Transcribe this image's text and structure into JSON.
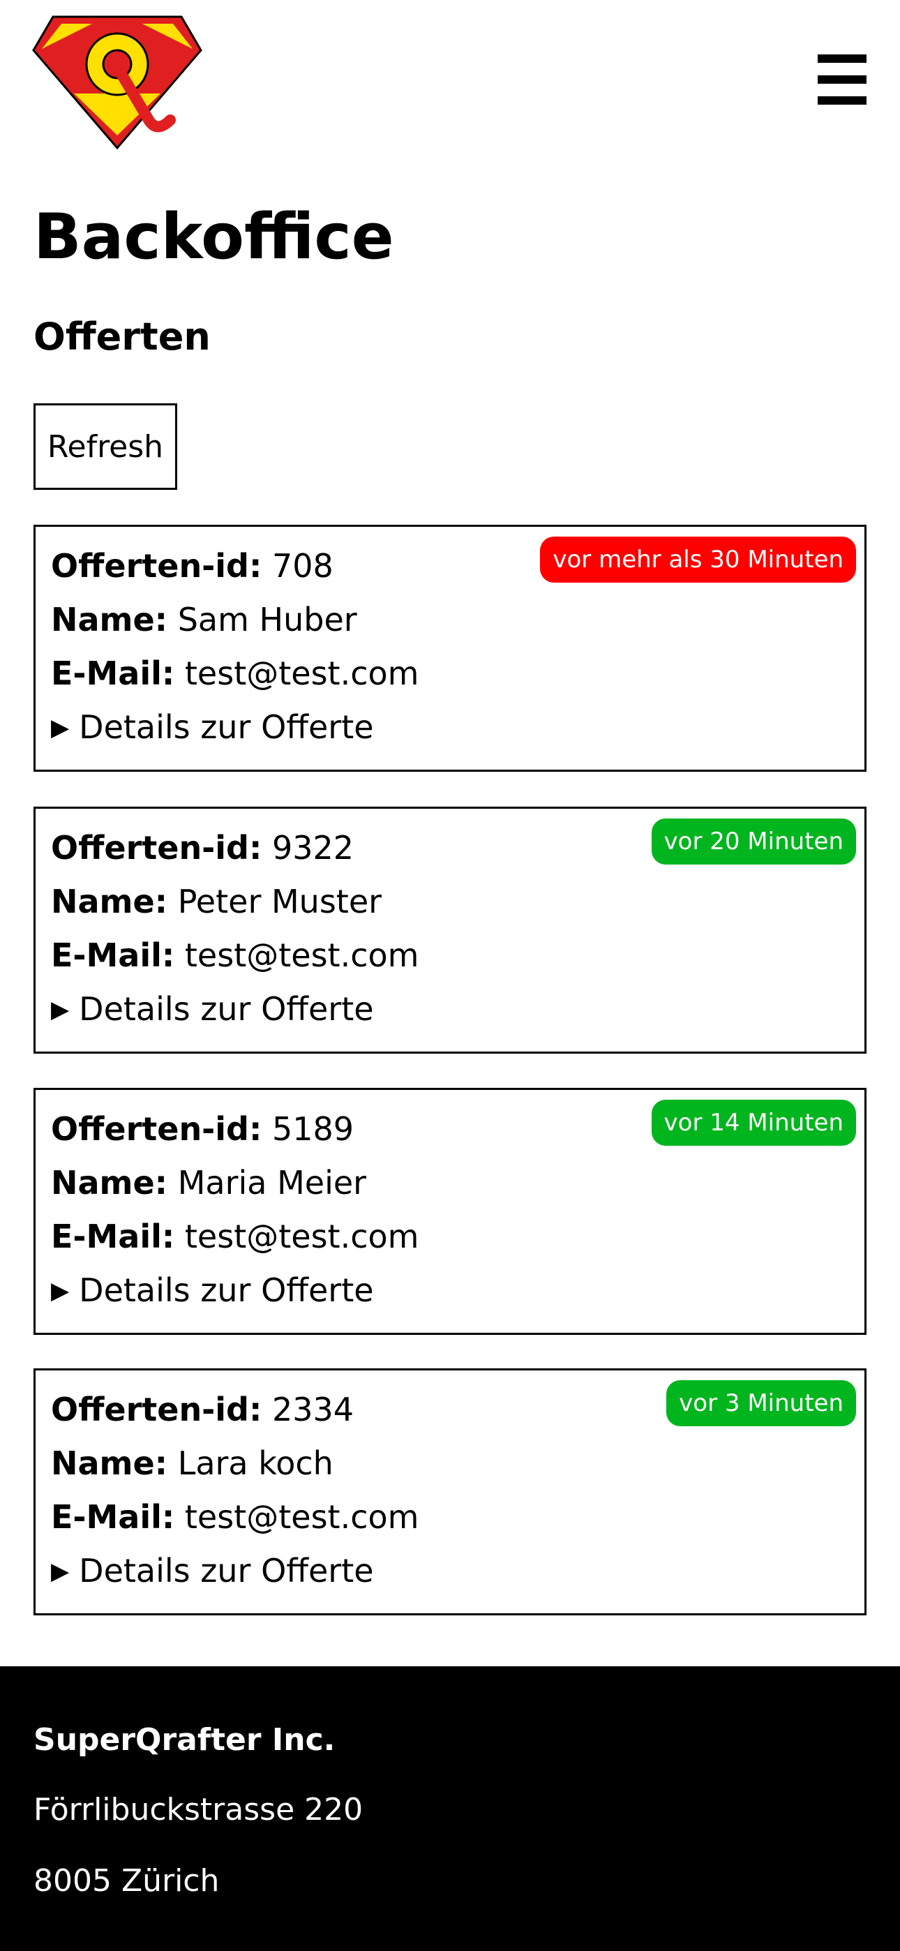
{
  "colors": {
    "badge_old": "#ff0000",
    "badge_recent": "#00b51e",
    "logo_red": "#e02020",
    "logo_yellow": "#ffe000",
    "footer_bg": "#000000"
  },
  "header": {
    "logo_icon": "superman-q-logo-icon",
    "menu_icon": "hamburger-menu-icon"
  },
  "page": {
    "title": "Backoffice",
    "section_title": "Offerten",
    "refresh_label": "Refresh"
  },
  "labels": {
    "id": "Offerten-id:",
    "name": "Name:",
    "email": "E-Mail:",
    "details": "Details zur Offerte"
  },
  "offers": [
    {
      "id": "708",
      "name": "Sam Huber",
      "email": "test@test.com",
      "badge": "vor mehr als 30 Minuten",
      "status": "old"
    },
    {
      "id": "9322",
      "name": "Peter Muster",
      "email": "test@test.com",
      "badge": "vor 20 Minuten",
      "status": "recent"
    },
    {
      "id": "5189",
      "name": "Maria Meier",
      "email": "test@test.com",
      "badge": "vor 14 Minuten",
      "status": "recent"
    },
    {
      "id": "2334",
      "name": "Lara koch",
      "email": "test@test.com",
      "badge": "vor 3 Minuten",
      "status": "recent"
    }
  ],
  "footer": {
    "company": "SuperQrafter Inc.",
    "street": "Förrlibuckstrasse 220",
    "city": "8005 Zürich"
  }
}
